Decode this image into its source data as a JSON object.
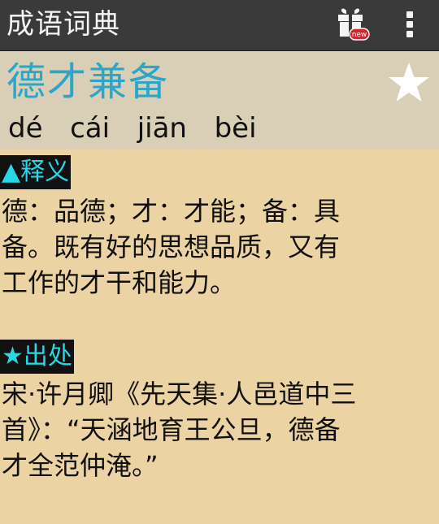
{
  "app_bar": {
    "title": "成语词典",
    "gift_icon": "gift-new-icon",
    "menu_icon": "overflow-menu-icon",
    "gift_badge": "new"
  },
  "entry": {
    "word": "德才兼备",
    "pinyin": "dé  cái  jiān  bèi",
    "favorite_icon": "star-icon"
  },
  "sections": [
    {
      "label": "▲释义",
      "lines": [
        "德：品德；才：才能；备：具",
        "备。既有好的思想品质，又有",
        "工作的才干和能力。"
      ]
    },
    {
      "label": "★出处",
      "lines": [
        "宋·许月卿《先天集·人邑道中三",
        "首》：“天涵地育王公旦，德备",
        "才全范仲淹。”"
      ]
    }
  ],
  "colors": {
    "app_bar": "#3a3a3a",
    "header": "#d9cfb6",
    "background": "#ecd3a3",
    "accent": "#2aa6c8",
    "label_text": "#29d6e6"
  }
}
